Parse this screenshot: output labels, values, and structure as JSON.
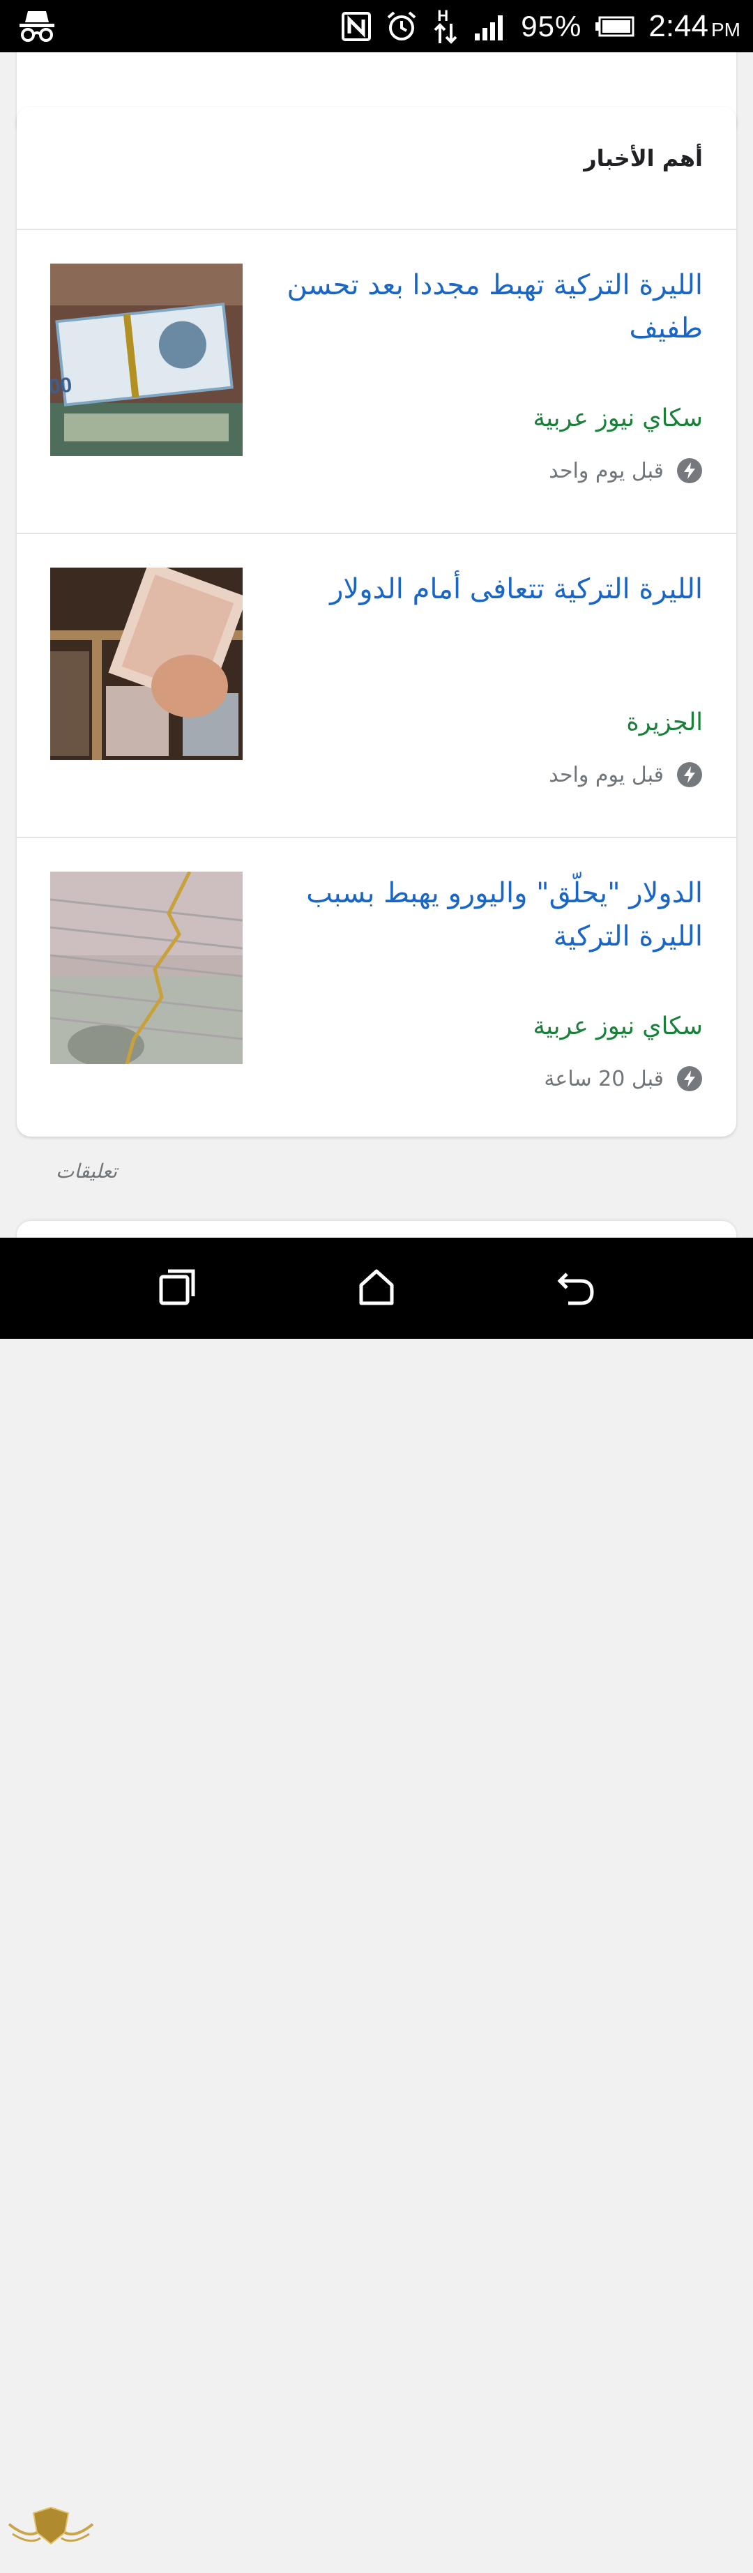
{
  "status_bar": {
    "battery_percent": "95%",
    "time": "2:44",
    "am_pm": "PM",
    "network_type": "H",
    "icons": [
      "incognito-icon",
      "nfc-icon",
      "alarm-icon",
      "data-transfer-icon",
      "signal-icon",
      "battery-icon"
    ]
  },
  "top_news": {
    "title": "أهم الأخبار",
    "items": [
      {
        "headline": "الليرة التركية تهبط مجددا بعد تحسن طفيف",
        "source": "سكاي نيوز عربية",
        "time": "قبل يوم واحد",
        "icon": "amp-bolt-icon"
      },
      {
        "headline": "الليرة التركية تتعافى أمام الدولار",
        "source": "الجزيرة",
        "time": "قبل يوم واحد",
        "icon": "amp-bolt-icon"
      },
      {
        "headline": "الدولار \"يحلّق\" واليورو يهبط بسبب الليرة التركية",
        "source": "سكاي نيوز عربية",
        "time": "قبل 20 ساعة",
        "icon": "amp-bolt-icon"
      }
    ]
  },
  "comments_label": "تعليقات",
  "nav_bar": {
    "icons": [
      "recents-icon",
      "home-icon",
      "back-icon"
    ]
  },
  "colors": {
    "headline": "#1a66c6",
    "source": "#188038",
    "meta": "#70757a"
  }
}
